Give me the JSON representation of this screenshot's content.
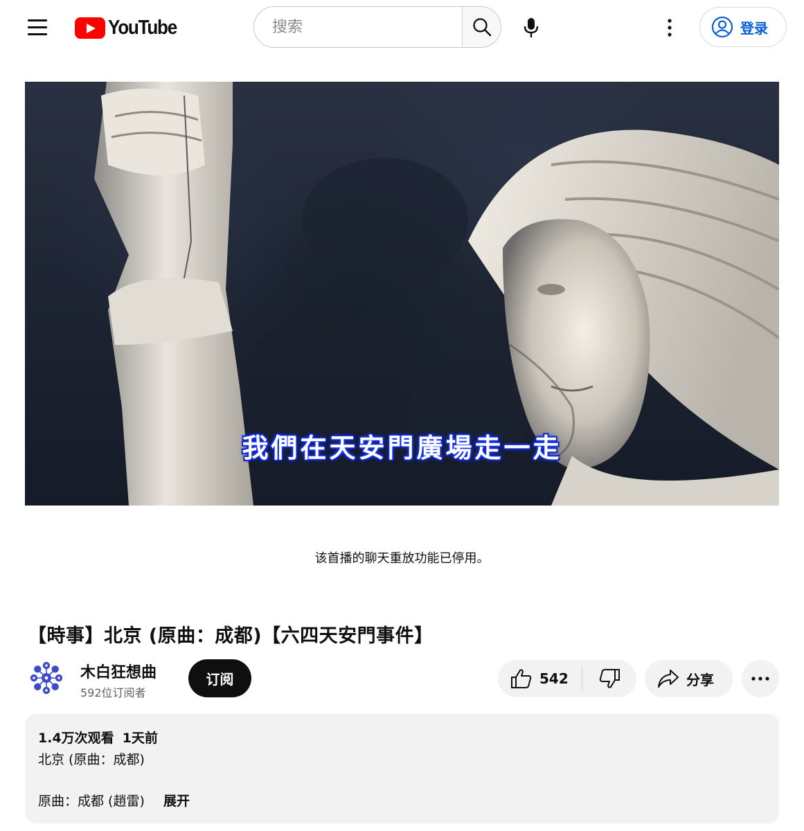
{
  "header": {
    "menu_icon": "hamburger-menu-icon",
    "logo_text": "YouTube",
    "search_placeholder": "搜索",
    "search_icon": "search-icon",
    "mic_icon": "microphone-icon",
    "more_icon": "vertical-dots-icon",
    "signin_label": "登录",
    "signin_icon": "account-circle-icon",
    "accent": "#065fd4",
    "brand_red": "#ff0000"
  },
  "video": {
    "subtitle": "我們在天安門廣場走一走"
  },
  "chat_notice": "该首播的聊天重放功能已停用。",
  "title": "【時事】北京 (原曲：成都)【六四天安門事件】",
  "channel": {
    "name": "木白狂想曲",
    "subscribers": "592位订阅者",
    "avatar_icon": "flower-logo-icon",
    "avatar_color": "#3d4bc7",
    "subscribe_label": "订阅"
  },
  "actions": {
    "like_count": "542",
    "like_icon": "thumbs-up-icon",
    "dislike_icon": "thumbs-down-icon",
    "share_label": "分享",
    "share_icon": "share-arrow-icon",
    "more_icon": "horizontal-dots-icon"
  },
  "description": {
    "views": "1.4万次观看",
    "date": "1天前",
    "line1": "北京 (原曲：成都)",
    "line2": "原曲：成都 (趙雷)",
    "expand_label": "展开"
  }
}
